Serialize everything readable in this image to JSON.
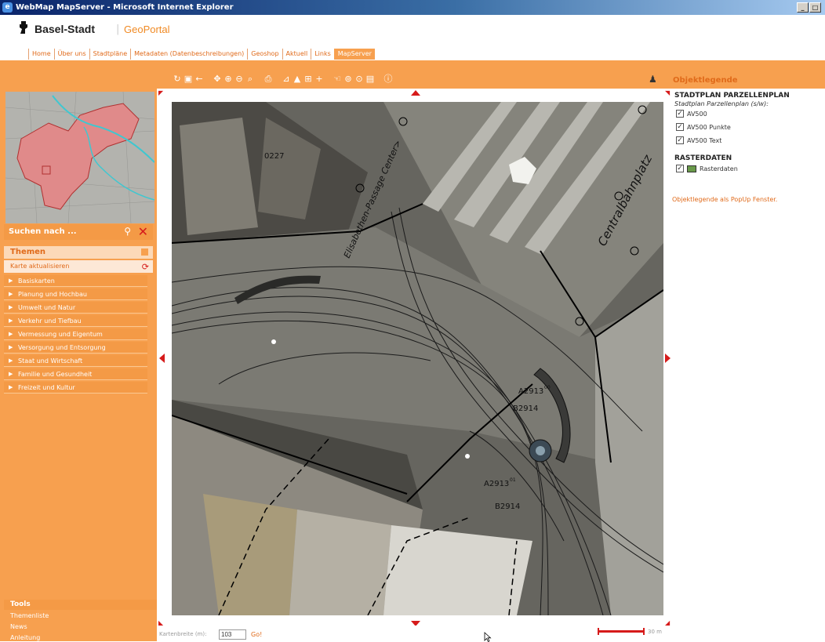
{
  "window": {
    "title": "WebMap MapServer - Microsoft Internet Explorer"
  },
  "header": {
    "brand": "Basel-Stadt",
    "separator": "|",
    "portal": "GeoPortal",
    "nav": [
      "Home",
      "Über uns",
      "Stadtpläne",
      "Metadaten (Datenbeschreibungen)",
      "Geoshop",
      "Aktuell",
      "Links",
      "MapServer"
    ],
    "active_nav": "MapServer"
  },
  "toolbar": {
    "icons": [
      "refresh-icon",
      "full-extent-icon",
      "back-icon",
      "pan-icon",
      "zoom-in-icon",
      "zoom-out-icon",
      "zoom-box-icon",
      "print-icon",
      "measure-icon",
      "area-icon",
      "query-icon",
      "add-icon",
      "select-icon",
      "buffer-icon",
      "identify-icon",
      "report-icon",
      "info-icon"
    ]
  },
  "left_panel": {
    "search_label": "Suchen nach ...",
    "themen_label": "Themen",
    "refresh_label": "Karte aktualisieren",
    "categories": [
      "Basiskarten",
      "Planung und Hochbau",
      "Umwelt und Natur",
      "Verkehr und Tiefbau",
      "Vermessung und Eigentum",
      "Versorgung und Entsorgung",
      "Staat und Wirtschaft",
      "Familie und Gesundheit",
      "Freizeit und Kultur"
    ],
    "tools_label": "Tools",
    "tool_links": [
      "Themenliste",
      "News",
      "Anleitung"
    ]
  },
  "map": {
    "labels": {
      "parcel_0227": "0227",
      "street_elisabethen": "Elisabethen-Passage Center>",
      "street_centralbahn": "Centralbahnplatz",
      "parcel_a2913_top": "A2913",
      "parcel_b2914_top": "B2914",
      "parcel_a2913_bottom": "A2913",
      "parcel_b2914_bottom": "B2914",
      "sup_00": "00",
      "sup_01": "01"
    }
  },
  "statusbar": {
    "scale_label": "Kartenbreite (m):",
    "scale_value": "103",
    "go_label": "Go!",
    "scale_unit": "30 m"
  },
  "legend": {
    "title": "Objektlegende",
    "section1_title": "STADTPLAN PARZELLENPLAN",
    "section1_subtitle": "Stadtplan Parzellenplan (s/w):",
    "section1_items": [
      "AV500",
      "AV500 Punkte",
      "AV500 Text"
    ],
    "section2_title": "RASTERDATEN",
    "section2_items": [
      "Rasterdaten"
    ],
    "popup_link": "Objektlegende als PopUp Fenster."
  },
  "colors": {
    "accent": "#f7a04f",
    "accent_dark": "#e06a1a",
    "alert": "#d61b1b"
  }
}
